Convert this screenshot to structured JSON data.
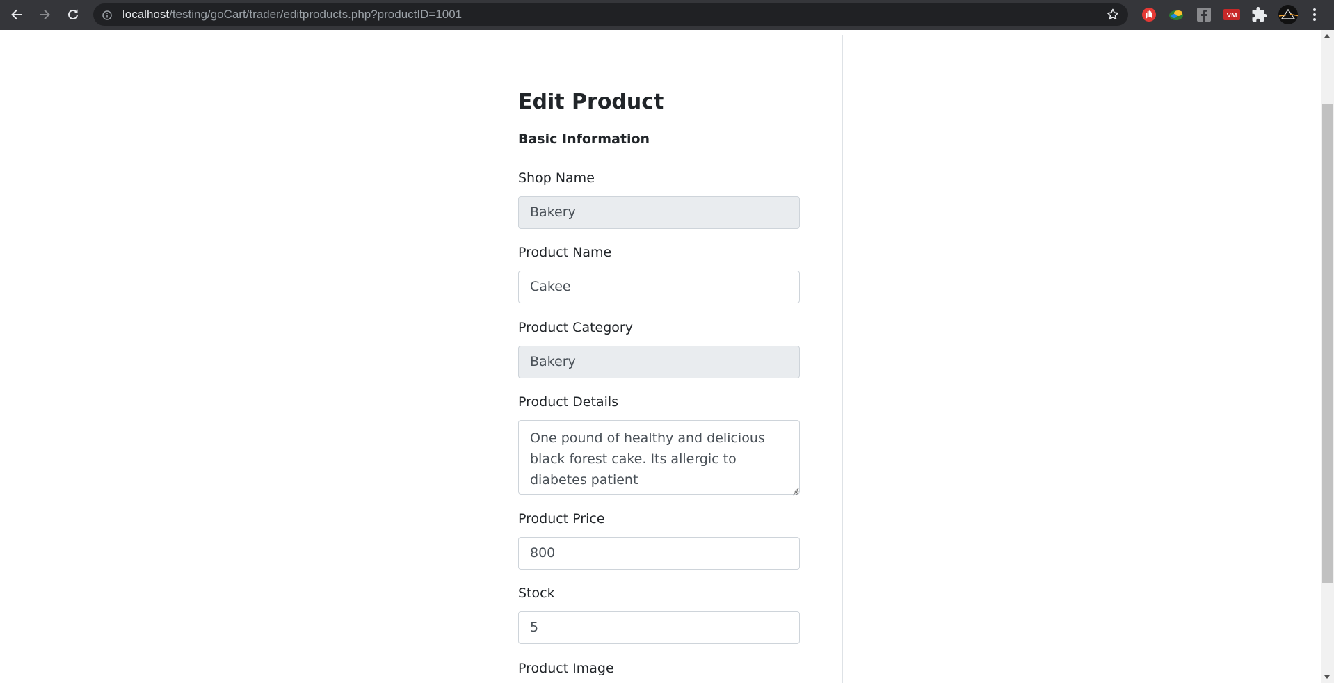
{
  "browser": {
    "url_host": "localhost",
    "url_path": "/testing/goCart/trader/editproducts.php?productID=1001",
    "nav_icons": [
      "back-arrow-icon",
      "forward-arrow-icon",
      "reload-icon"
    ],
    "extension_icons": [
      "stop-hand-extension-icon",
      "color-extension-icon",
      "facebook-extension-icon",
      "vm-extension-icon",
      "puzzle-extensions-icon",
      "profile-avatar-icon",
      "kebab-menu-icon"
    ]
  },
  "form": {
    "title": "Edit Product",
    "section": "Basic Information",
    "shop_name": {
      "label": "Shop Name",
      "value": "Bakery",
      "disabled": true
    },
    "product_name": {
      "label": "Product Name",
      "value": "Cakee"
    },
    "product_category": {
      "label": "Product Category",
      "value": "Bakery",
      "disabled": true
    },
    "product_details": {
      "label": "Product Details",
      "value": "One pound of healthy and delicious black forest cake. Its allergic to diabetes patient"
    },
    "product_price": {
      "label": "Product Price",
      "value": "800"
    },
    "stock": {
      "label": "Stock",
      "value": "5"
    },
    "product_image": {
      "label": "Product Image"
    }
  },
  "colors": {
    "toolbar_bg": "#35363a",
    "omnibox_bg": "#202124",
    "disabled_input_bg": "#e9ecef",
    "input_border": "#ced4da",
    "card_border": "#dee2e6"
  }
}
